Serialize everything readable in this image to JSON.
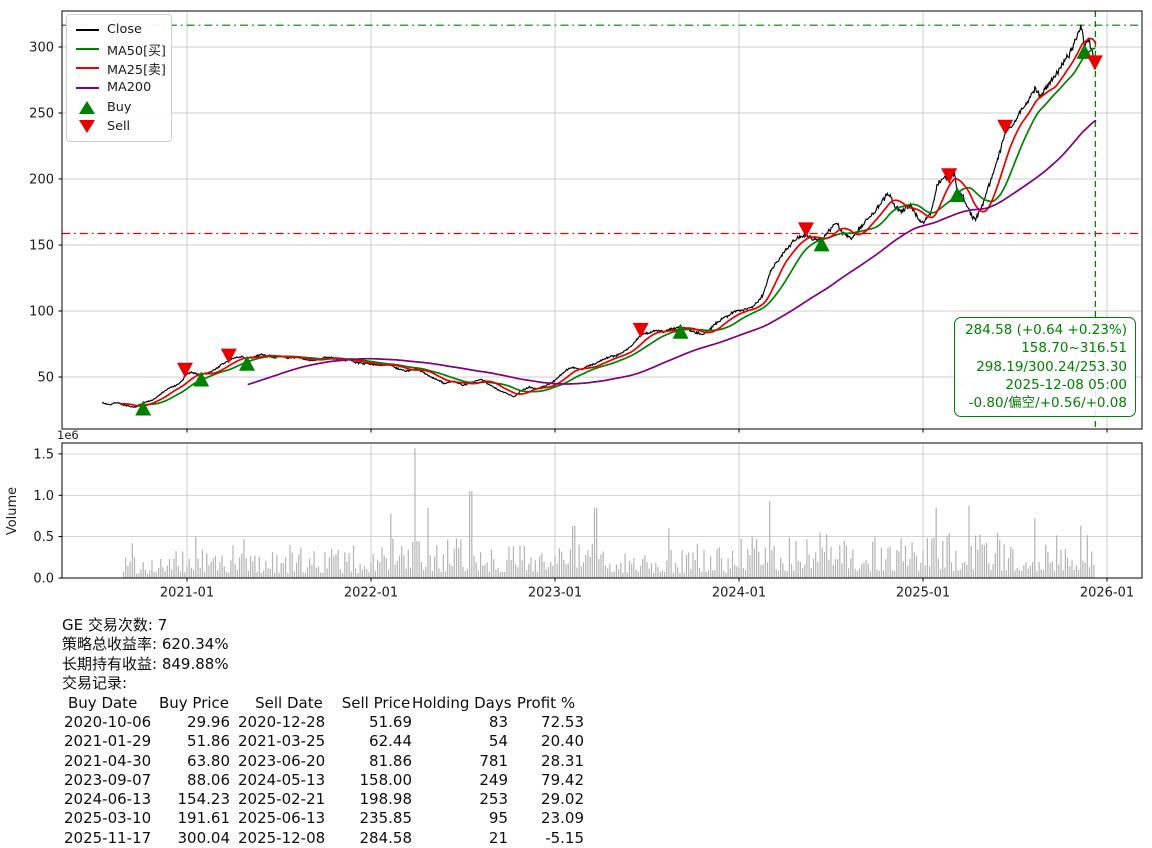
{
  "summary": {
    "trade_count_label": "GE 交易次数:",
    "trade_count": "7",
    "strategy_return_label": "策略总收益率:",
    "strategy_return": "620.34%",
    "hold_return_label": "长期持有收益:",
    "hold_return": "849.88%",
    "records_label": "交易记录:"
  },
  "trade_table": {
    "headers": [
      "Buy Date",
      "Buy Price",
      "Sell Date",
      "Sell Price",
      "Holding Days",
      "Profit %"
    ],
    "rows": [
      [
        "2020-10-06",
        "29.96",
        "2020-12-28",
        "51.69",
        "83",
        "72.53"
      ],
      [
        "2021-01-29",
        "51.86",
        "2021-03-25",
        "62.44",
        "54",
        "20.40"
      ],
      [
        "2021-04-30",
        "63.80",
        "2023-06-20",
        "81.86",
        "781",
        "28.31"
      ],
      [
        "2023-09-07",
        "88.06",
        "2024-05-13",
        "158.00",
        "249",
        "79.42"
      ],
      [
        "2024-06-13",
        "154.23",
        "2025-02-21",
        "198.98",
        "253",
        "29.02"
      ],
      [
        "2025-03-10",
        "191.61",
        "2025-06-13",
        "235.85",
        "95",
        "23.09"
      ],
      [
        "2025-11-17",
        "300.04",
        "2025-12-08",
        "284.58",
        "21",
        "-5.15"
      ]
    ]
  },
  "legend": {
    "items": [
      {
        "label": "Close",
        "type": "line",
        "color": "#000000"
      },
      {
        "label": "MA50[买]",
        "type": "line",
        "color": "#008000"
      },
      {
        "label": "MA25[卖]",
        "type": "line",
        "color": "#e60000"
      },
      {
        "label": "MA200",
        "type": "line",
        "color": "#800080"
      },
      {
        "label": "Buy",
        "type": "marker-up",
        "color": "#008000"
      },
      {
        "label": "Sell",
        "type": "marker-down",
        "color": "#e60000"
      }
    ]
  },
  "info_box": {
    "color": "#008000",
    "lines": [
      "284.58 (+0.64 +0.23%)",
      "158.70~316.51",
      "298.19/300.24/253.30",
      "2025-12-08 05:00",
      "-0.80/偏空/+0.56/+0.08"
    ]
  },
  "chart_data": {
    "type": "line",
    "title": "",
    "xlabel": "",
    "ylabel": "",
    "x_ticks": [
      {
        "label": "2021-01",
        "t": 0
      },
      {
        "label": "2022-01",
        "t": 1
      },
      {
        "label": "2023-01",
        "t": 2
      },
      {
        "label": "2024-01",
        "t": 3
      },
      {
        "label": "2025-01",
        "t": 4
      },
      {
        "label": "2026-01",
        "t": 5
      }
    ],
    "y_ticks": [
      50,
      100,
      150,
      200,
      250,
      300
    ],
    "ylim": [
      11,
      327
    ],
    "grid": true,
    "legend_position": "upper-left",
    "close_series": {
      "name": "Close",
      "color": "#000000",
      "anchors": [
        [
          -0.46,
          30.5
        ],
        [
          -0.42,
          29
        ],
        [
          -0.38,
          30.8
        ],
        [
          -0.34,
          28.5
        ],
        [
          -0.29,
          27
        ],
        [
          -0.26,
          28.5
        ],
        [
          -0.24,
          30
        ],
        [
          -0.21,
          31.5
        ],
        [
          -0.17,
          34
        ],
        [
          -0.13,
          38.5
        ],
        [
          -0.09,
          42
        ],
        [
          -0.05,
          44
        ],
        [
          -0.02,
          48
        ],
        [
          -0.011,
          51.7
        ],
        [
          0.03,
          53.5
        ],
        [
          0.06,
          52
        ],
        [
          0.077,
          51.9
        ],
        [
          0.11,
          53
        ],
        [
          0.15,
          55.5
        ],
        [
          0.19,
          59.5
        ],
        [
          0.227,
          62.4
        ],
        [
          0.26,
          64.5
        ],
        [
          0.3,
          65.5
        ],
        [
          0.326,
          63.8
        ],
        [
          0.36,
          65
        ],
        [
          0.4,
          67.2
        ],
        [
          0.44,
          66
        ],
        [
          0.48,
          64.8
        ],
        [
          0.52,
          65.6
        ],
        [
          0.56,
          64
        ],
        [
          0.6,
          64.8
        ],
        [
          0.64,
          63.2
        ],
        [
          0.68,
          62.6
        ],
        [
          0.72,
          63.6
        ],
        [
          0.76,
          65
        ],
        [
          0.8,
          64
        ],
        [
          0.84,
          62.5
        ],
        [
          0.88,
          63.2
        ],
        [
          0.92,
          61
        ],
        [
          0.96,
          60.3
        ],
        [
          1.0,
          60
        ],
        [
          1.05,
          58.5
        ],
        [
          1.1,
          59.6
        ],
        [
          1.15,
          56
        ],
        [
          1.2,
          54.5
        ],
        [
          1.25,
          56
        ],
        [
          1.3,
          52
        ],
        [
          1.35,
          48.5
        ],
        [
          1.4,
          45
        ],
        [
          1.45,
          47
        ],
        [
          1.5,
          43.5
        ],
        [
          1.55,
          46
        ],
        [
          1.6,
          48.5
        ],
        [
          1.64,
          44.5
        ],
        [
          1.7,
          39.5
        ],
        [
          1.75,
          36.8
        ],
        [
          1.78,
          35.2
        ],
        [
          1.82,
          40
        ],
        [
          1.86,
          42.5
        ],
        [
          1.9,
          41
        ],
        [
          1.94,
          43
        ],
        [
          1.98,
          45.5
        ],
        [
          2.02,
          50
        ],
        [
          2.06,
          55
        ],
        [
          2.1,
          57.5
        ],
        [
          2.14,
          55.5
        ],
        [
          2.18,
          58.5
        ],
        [
          2.22,
          60
        ],
        [
          2.26,
          63.5
        ],
        [
          2.3,
          65.5
        ],
        [
          2.34,
          66.5
        ],
        [
          2.38,
          70
        ],
        [
          2.42,
          74
        ],
        [
          2.466,
          81.9
        ],
        [
          2.51,
          83.5
        ],
        [
          2.55,
          85.5
        ],
        [
          2.59,
          84
        ],
        [
          2.63,
          86.5
        ],
        [
          2.682,
          88.1
        ],
        [
          2.72,
          86.5
        ],
        [
          2.76,
          84
        ],
        [
          2.8,
          82.5
        ],
        [
          2.84,
          86
        ],
        [
          2.88,
          91
        ],
        [
          2.92,
          95
        ],
        [
          2.96,
          98.5
        ],
        [
          3.0,
          100.5
        ],
        [
          3.05,
          102
        ],
        [
          3.09,
          105
        ],
        [
          3.13,
          112
        ],
        [
          3.17,
          130
        ],
        [
          3.21,
          138
        ],
        [
          3.25,
          146
        ],
        [
          3.29,
          152
        ],
        [
          3.33,
          156
        ],
        [
          3.364,
          158
        ],
        [
          3.41,
          153.5
        ],
        [
          3.449,
          154.2
        ],
        [
          3.49,
          161
        ],
        [
          3.53,
          166.5
        ],
        [
          3.57,
          158
        ],
        [
          3.61,
          155
        ],
        [
          3.65,
          162
        ],
        [
          3.69,
          168
        ],
        [
          3.73,
          174
        ],
        [
          3.77,
          181
        ],
        [
          3.81,
          189
        ],
        [
          3.85,
          179
        ],
        [
          3.89,
          175.5
        ],
        [
          3.93,
          181
        ],
        [
          3.97,
          171
        ],
        [
          4.0,
          167
        ],
        [
          4.04,
          174
        ],
        [
          4.08,
          196
        ],
        [
          4.12,
          202
        ],
        [
          4.142,
          199
        ],
        [
          4.17,
          205
        ],
        [
          4.186,
          191.6
        ],
        [
          4.22,
          186
        ],
        [
          4.25,
          176
        ],
        [
          4.28,
          169
        ],
        [
          4.32,
          179
        ],
        [
          4.36,
          196
        ],
        [
          4.4,
          212
        ],
        [
          4.447,
          235.9
        ],
        [
          4.49,
          241
        ],
        [
          4.53,
          251
        ],
        [
          4.57,
          260
        ],
        [
          4.61,
          268
        ],
        [
          4.64,
          262
        ],
        [
          4.68,
          272
        ],
        [
          4.72,
          279
        ],
        [
          4.76,
          287
        ],
        [
          4.8,
          296
        ],
        [
          4.83,
          305
        ],
        [
          4.86,
          316.5
        ],
        [
          4.877,
          300
        ],
        [
          4.9,
          306
        ],
        [
          4.92,
          296
        ],
        [
          4.937,
          284.6
        ]
      ]
    },
    "ma_series": [
      {
        "name": "MA50",
        "color": "#008000",
        "window": 50
      },
      {
        "name": "MA25",
        "color": "#e60000",
        "window": 25
      },
      {
        "name": "MA200",
        "color": "#800080",
        "window": 200
      }
    ],
    "hlines": [
      {
        "level": 316.51,
        "color": "#008000",
        "style": "dashdot"
      },
      {
        "level": 158.7,
        "color": "#e60000",
        "style": "dashdot"
      }
    ],
    "vline": {
      "t": 4.937,
      "date": "2025-12-08",
      "color": "#008000",
      "style": "dashed"
    },
    "markers": [
      {
        "type": "buy",
        "t": -0.238,
        "price": 29.96,
        "date": "2020-10-06"
      },
      {
        "type": "sell",
        "t": -0.011,
        "price": 51.69,
        "date": "2020-12-28"
      },
      {
        "type": "buy",
        "t": 0.077,
        "price": 51.86,
        "date": "2021-01-29"
      },
      {
        "type": "sell",
        "t": 0.227,
        "price": 62.44,
        "date": "2021-03-25"
      },
      {
        "type": "buy",
        "t": 0.326,
        "price": 63.8,
        "date": "2021-04-30"
      },
      {
        "type": "sell",
        "t": 2.466,
        "price": 81.86,
        "date": "2023-06-20"
      },
      {
        "type": "buy",
        "t": 2.682,
        "price": 88.06,
        "date": "2023-09-07"
      },
      {
        "type": "sell",
        "t": 3.364,
        "price": 158.0,
        "date": "2024-05-13"
      },
      {
        "type": "buy",
        "t": 3.449,
        "price": 154.23,
        "date": "2024-06-13"
      },
      {
        "type": "sell",
        "t": 4.142,
        "price": 198.98,
        "date": "2025-02-21"
      },
      {
        "type": "buy",
        "t": 4.186,
        "price": 191.61,
        "date": "2025-03-10"
      },
      {
        "type": "sell",
        "t": 4.447,
        "price": 235.85,
        "date": "2025-06-13"
      },
      {
        "type": "buy",
        "t": 4.877,
        "price": 300.04,
        "date": "2025-11-17"
      },
      {
        "type": "sell",
        "t": 4.934,
        "price": 284.58,
        "date": "2025-12-08"
      }
    ],
    "volume": {
      "axis_label": "Volume",
      "multiplier_label": "1e6",
      "y_ticks": [
        0.0,
        0.5,
        1.0,
        1.5
      ],
      "color": "#b3b3b3",
      "t_start": -0.345,
      "t_end": 4.937,
      "spikes": [
        {
          "t": -0.3,
          "v": 0.42
        },
        {
          "t": 0.05,
          "v": 0.5
        },
        {
          "t": 0.31,
          "v": 0.47
        },
        {
          "t": 1.11,
          "v": 0.78
        },
        {
          "t": 1.24,
          "v": 1.57
        },
        {
          "t": 1.31,
          "v": 0.85
        },
        {
          "t": 1.54,
          "v": 1.05
        },
        {
          "t": 2.1,
          "v": 0.63
        },
        {
          "t": 2.22,
          "v": 0.85
        },
        {
          "t": 2.62,
          "v": 0.6
        },
        {
          "t": 3.17,
          "v": 0.93
        },
        {
          "t": 3.44,
          "v": 0.55
        },
        {
          "t": 4.07,
          "v": 0.85
        },
        {
          "t": 4.25,
          "v": 0.88
        },
        {
          "t": 4.61,
          "v": 0.72
        },
        {
          "t": 4.86,
          "v": 0.63
        }
      ]
    }
  }
}
